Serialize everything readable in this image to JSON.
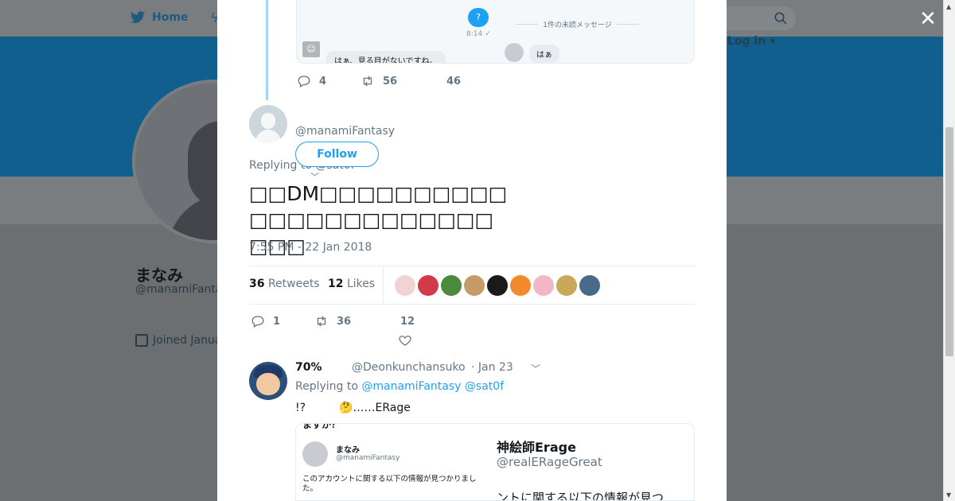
{
  "nav": {
    "home_label": "Home",
    "login_label": "Log in ▾"
  },
  "profile": {
    "name": "まなみ",
    "handle": "@manamiFanta",
    "joined": "Joined Janua"
  },
  "previous_tweet": {
    "dm_question": "?",
    "dm_time": "8:14 ✓",
    "dm_reply_left": "はぁ、見る目がないですね。",
    "dm_unread": "1件の未読メッセージ",
    "dm_reply_right": "はぁ",
    "dm_face": "☺",
    "replies": "4",
    "retweets": "56",
    "likes": "46"
  },
  "tweet": {
    "handle": "@manamiFantasy",
    "follow_label": "Follow",
    "replying_label": "Replying to @sat0f",
    "text": "□□DM□□□□□□□□□□□□□□□□□□□□□□□□□□",
    "timestamp": "7:55 PM - 22 Jan 2018",
    "retweet_count": "36",
    "retweet_label": "Retweets",
    "like_count": "12",
    "like_label": "Likes",
    "action_replies": "1",
    "action_retweets": "36",
    "action_likes": "12"
  },
  "likers_colors": [
    "#f1d3d6",
    "#d23a4a",
    "#4b8a3a",
    "#c79a6a",
    "#1a1a1a",
    "#f08a2a",
    "#f3b6c8",
    "#c9a85a",
    "#4a6a8a"
  ],
  "reply": {
    "name": "70%",
    "handle": "@Deonkunchansuko",
    "date": "· Jan 23",
    "replying_prefix": "Replying to ",
    "mention1": "@manamiFantasy",
    "mention2": "@sat0f",
    "text": "!?　　　🤔……ERage",
    "img_top": "ますか？",
    "img_name": "まなみ",
    "img_handle": "@manamiFantasy",
    "img_msg": "このアカウントに関する以下の情報が見つかりました。",
    "img_right_name": "神絵師Erage",
    "img_right_handle": "@realERageGreat",
    "img_right_msg": "ントに関する以下の情報が見つ"
  }
}
